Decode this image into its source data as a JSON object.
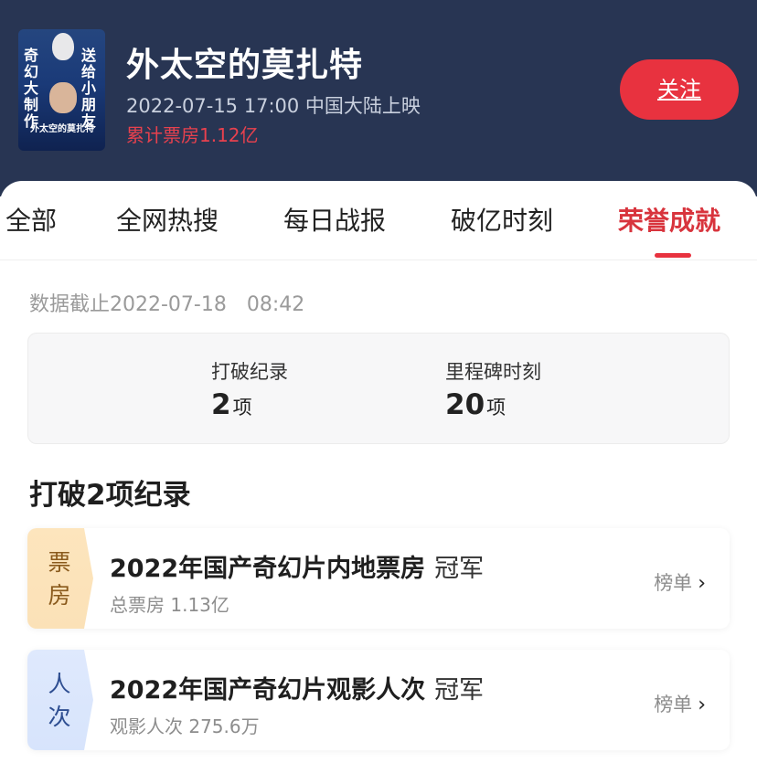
{
  "movie": {
    "poster_text_left": "奇幻大制作",
    "poster_text_right": "送给小朋友",
    "poster_title": "外太空的莫扎特",
    "title": "外太空的莫扎特",
    "release": "2022-07-15 17:00 中国大陆上映",
    "boxoffice_label": "累计票房",
    "boxoffice_value": "1.12亿",
    "follow_label": "关注"
  },
  "tabs": [
    {
      "label": "全部",
      "active": false
    },
    {
      "label": "全网热搜",
      "active": false
    },
    {
      "label": "每日战报",
      "active": false
    },
    {
      "label": "破亿时刻",
      "active": false
    },
    {
      "label": "荣誉成就",
      "active": true
    }
  ],
  "cutoff": "数据截止2022-07-18　08:42",
  "summary": {
    "records_label": "打破纪录",
    "records_value": "2",
    "records_unit": "项",
    "milestones_label": "里程碑时刻",
    "milestones_value": "20",
    "milestones_unit": "项"
  },
  "section_title": "打破2项纪录",
  "records": [
    {
      "badge": "票房",
      "title": "2022年国产奇幻片内地票房",
      "rank": "冠军",
      "sub": "总票房 1.13亿",
      "link": "榜单"
    },
    {
      "badge": "人次",
      "title": "2022年国产奇幻片观影人次",
      "rank": "冠军",
      "sub": "观影人次 275.6万",
      "link": "榜单"
    }
  ],
  "colors": {
    "header_bg": "#283553",
    "accent_red": "#e8323f",
    "badge_gold": "#fbe1b7",
    "badge_blue": "#d7e4fc"
  },
  "icons": {
    "chevron": "chevron-right-icon"
  }
}
